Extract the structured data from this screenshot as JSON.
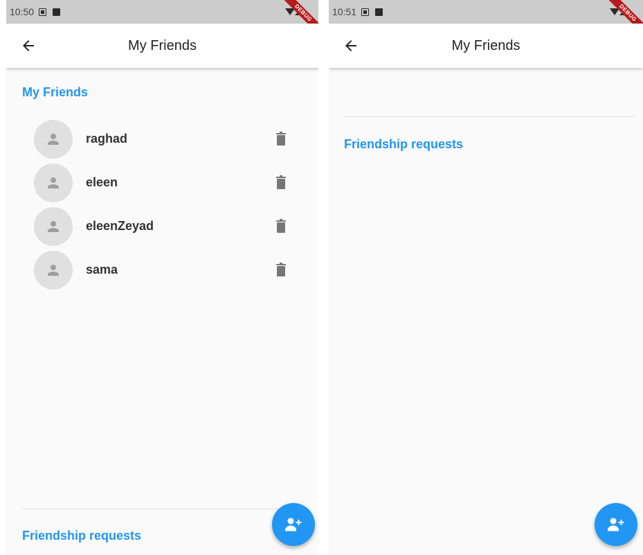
{
  "screens": [
    {
      "status_time": "10:50",
      "debug_banner": "DEBUG",
      "app_title": "My Friends",
      "friends_header": "My Friends",
      "friends": [
        {
          "name": "raghad"
        },
        {
          "name": "eleen"
        },
        {
          "name": "eleenZeyad"
        },
        {
          "name": "sama"
        }
      ],
      "requests_header": "Friendship requests"
    },
    {
      "status_time": "10:51",
      "debug_banner": "DEBUG",
      "app_title": "My Friends",
      "requests_header": "Friendship requests"
    }
  ],
  "icons": {
    "back": "arrow-left-icon",
    "avatar": "person-icon",
    "delete": "trash-icon",
    "fab": "add-person-icon"
  },
  "colors": {
    "accent": "#2196f3",
    "status_bar": "#cccccc",
    "background": "#fafafa",
    "debug_banner": "#b71c1c"
  }
}
